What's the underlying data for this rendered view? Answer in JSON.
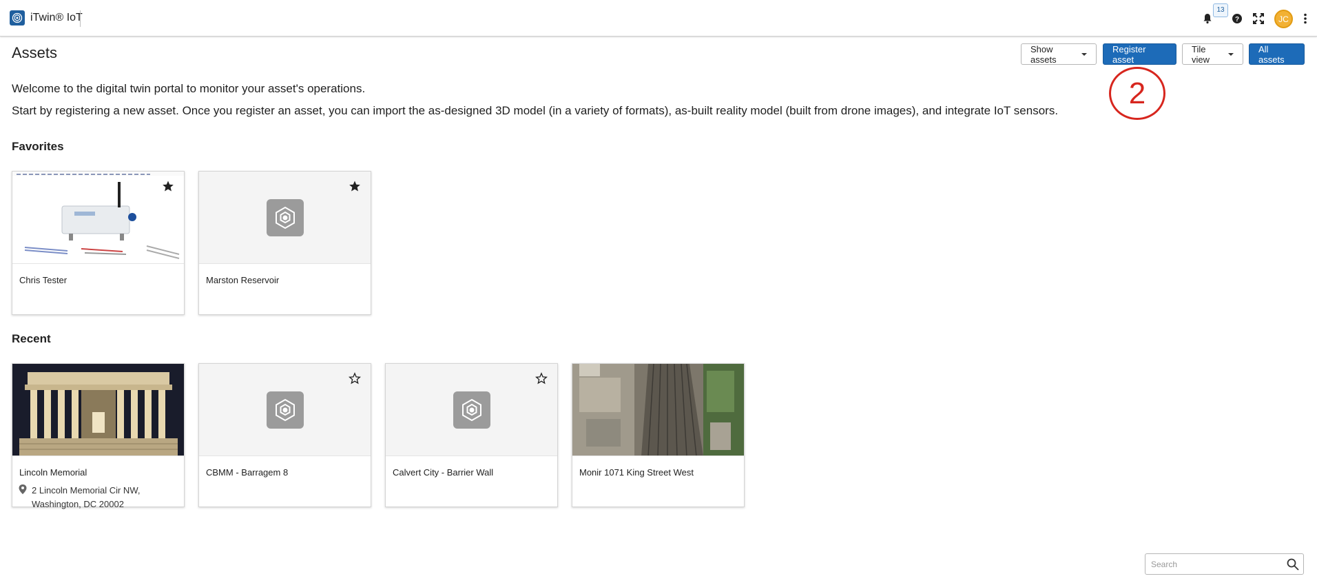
{
  "app": {
    "name": "iTwin® IoT"
  },
  "header": {
    "notifications_count": "13",
    "avatar_initials": "JC",
    "icons": [
      "bell-icon",
      "help-icon",
      "fullscreen-icon",
      "more-vertical-icon"
    ]
  },
  "page": {
    "title": "Assets"
  },
  "toolbar": {
    "show_assets_label": "Show assets",
    "register_asset_label": "Register asset",
    "tile_view_label": "Tile view",
    "all_assets_label": "All assets"
  },
  "annotation": {
    "number": "2",
    "color": "#d7261e"
  },
  "intro": {
    "line1": "Welcome to the digital twin portal to monitor your asset's operations.",
    "line2": "Start by registering a new asset. Once you register an asset, you can import the as-designed 3D model (in a variety of formats), as-built reality model (built from drone images), and integrate IoT sensors."
  },
  "favorites": {
    "title": "Favorites",
    "items": [
      {
        "name": "Chris Tester",
        "favorite": true,
        "thumb": "sensor-photo"
      },
      {
        "name": "Marston Reservoir",
        "favorite": true,
        "thumb": "placeholder"
      }
    ]
  },
  "recent": {
    "title": "Recent",
    "items": [
      {
        "name": "Lincoln Memorial",
        "address_line1": "2 Lincoln Memorial Cir NW,",
        "address_line2": "Washington, DC 20002",
        "favorite": false,
        "thumb": "memorial-photo"
      },
      {
        "name": "CBMM - Barragem 8",
        "favorite": false,
        "thumb": "placeholder"
      },
      {
        "name": "Calvert City - Barrier Wall",
        "favorite": false,
        "thumb": "placeholder"
      },
      {
        "name": "Monir 1071 King Street West",
        "favorite": false,
        "thumb": "aerial-photo"
      }
    ]
  },
  "search": {
    "placeholder": "Search"
  },
  "colors": {
    "primary": "#1d6bb8",
    "avatar": "#f2b134"
  }
}
